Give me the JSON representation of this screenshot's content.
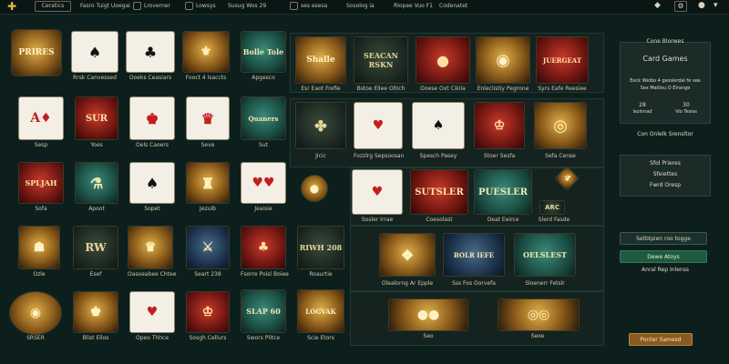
{
  "topbar": {
    "brand_icon": "plus-icon",
    "account_label": "Ceratics",
    "item1": "Fasro Tuigt Uoegai",
    "item2": "Lroverner",
    "item3": "Lowsys",
    "item4": "Susug Wos 29",
    "item5": "ses esesa",
    "item6": "Sosolog ia",
    "item7": "Rlopee Vuo F1",
    "item8": "Codenatet",
    "icons": [
      "bell-icon",
      "settings-icon",
      "chevron-down-icon"
    ]
  },
  "row1": [
    {
      "text": "PRIRES",
      "caption": ""
    },
    {
      "text": "",
      "caption": "Rrsk Canvessed"
    },
    {
      "text": "",
      "caption": "Ooeks Ceasiars"
    },
    {
      "text": "",
      "caption": "Fooct 4 Isaccts"
    },
    {
      "text": "Bolle Tole",
      "caption": "Apgesco"
    },
    {
      "text": "Shalle",
      "caption": "Esr Eaot Frefie"
    },
    {
      "text": "SEACAN RSKN",
      "caption": "Bstoe Ellee Oltich"
    },
    {
      "text": "",
      "caption": "Ooese Oxt Cikila"
    },
    {
      "text": "",
      "caption": "Enleclistiy Pegrone"
    },
    {
      "text": "JUERGEAT",
      "caption": "Syrs Eafe Reesiee"
    }
  ],
  "row2": [
    {
      "text": "A",
      "caption": "Sesp"
    },
    {
      "text": "SUR",
      "caption": "Yoes"
    },
    {
      "text": "",
      "caption": "Oels Caoers"
    },
    {
      "text": "",
      "caption": "Seve"
    },
    {
      "text": "Quaners",
      "caption": "Sut"
    },
    {
      "text": "",
      "caption": "Jicic"
    },
    {
      "text": "",
      "caption": "Fozzlrg Sepsoosan"
    },
    {
      "text": "",
      "caption": "Spesch Pasey"
    },
    {
      "text": "",
      "caption": "Stoer Sesfa"
    },
    {
      "text": "",
      "caption": "Sefa Cense"
    }
  ],
  "row3": [
    {
      "text": "SPLJAH",
      "caption": "Sofa"
    },
    {
      "text": "",
      "caption": "Sopet"
    },
    {
      "text": "",
      "caption": "Apoot"
    },
    {
      "text": "",
      "caption": "Jezuib"
    },
    {
      "text": "",
      "caption": "Jeaisie"
    },
    {
      "text": "",
      "caption": "Sosler Irrae"
    },
    {
      "text": "SUTSLER",
      "caption": "Coesolast"
    },
    {
      "text": "PUESLER",
      "caption": "Oeat Eeirce"
    },
    {
      "text": "ARC",
      "caption": "Slerd Fasde"
    }
  ],
  "row4": [
    {
      "text": "",
      "caption": "Ozle"
    },
    {
      "text": "RW",
      "caption": "Esef"
    },
    {
      "text": "",
      "caption": "Oasoeabee Chtee"
    },
    {
      "text": "",
      "caption": "Seart 238"
    },
    {
      "text": "",
      "caption": "Fsorre Poisl Boiee"
    },
    {
      "text": "RIWH 208",
      "caption": "Roaurtie"
    },
    {
      "text": "",
      "caption": "Olealorng Ar Epple"
    },
    {
      "text": "BOLR IEFE",
      "caption": "Sss Fos Oorvefa"
    },
    {
      "text": "OELSLEST",
      "caption": "Sloenerr Fetslr"
    }
  ],
  "row5": [
    {
      "text": "",
      "caption": "SRSER"
    },
    {
      "text": "",
      "caption": "Blist Ellos"
    },
    {
      "text": "",
      "caption": "Opeo Thhce"
    },
    {
      "text": "",
      "caption": "Sosgh Cellurs"
    },
    {
      "text": "SLAP 60",
      "caption": "Swors Plitce"
    },
    {
      "text": "LOGVAK",
      "caption": "Scie Etors"
    },
    {
      "text": "",
      "caption": "Seo"
    },
    {
      "text": "",
      "caption": "Sexe"
    }
  ],
  "side": {
    "title": "Cone Blorwes",
    "heading": "Card Games",
    "line1": "Eeck Weibo 4 gsoslerdal fe see",
    "line2": "Sex Maillou O Elrange",
    "stat1_value": "28",
    "stat1_label": "Isolnnad",
    "stat2_value": "30",
    "stat2_label": "Vio Tesiss",
    "link": "Con Onlelk Srensltor",
    "card2_line1": "Sfol Prieres",
    "card2_line2": "Sfeiettes",
    "card2_line3": "Fwrd Oresp",
    "btn1": "Setbtpien roo togge",
    "btn2": "Dewe Atoys",
    "note": "Anral Rep Inlenss",
    "btn3": "Ponter Samesd"
  }
}
